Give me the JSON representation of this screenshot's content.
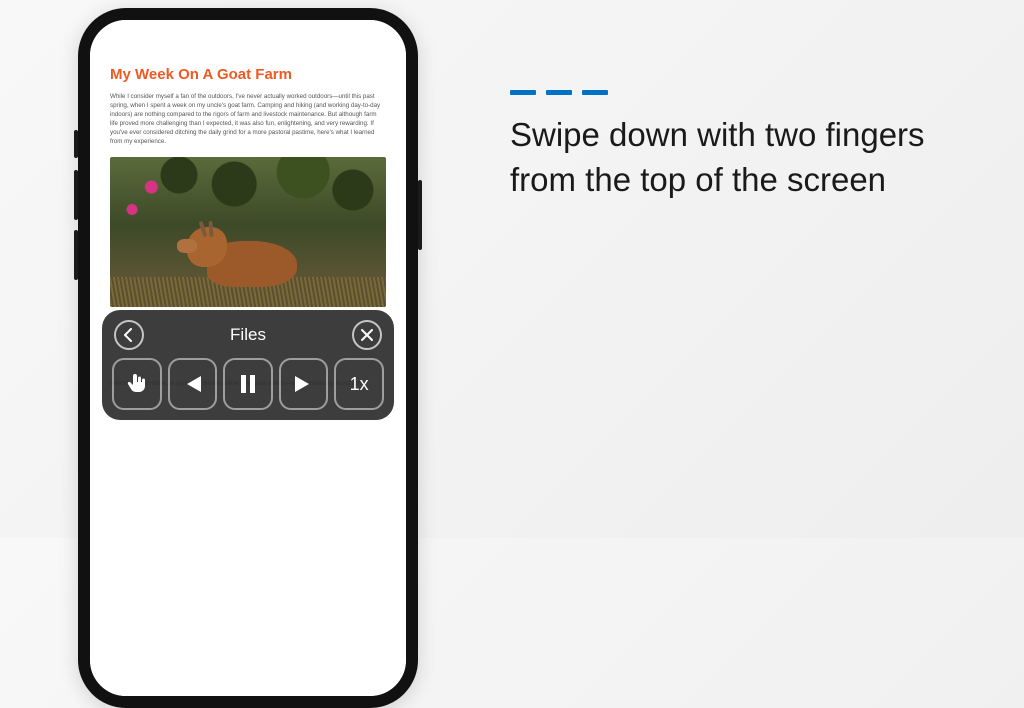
{
  "document": {
    "title": "My Week On A Goat Farm",
    "body": "While I consider myself a fan of the outdoors, I've never actually worked outdoors—until this past spring, when I spent a week on my uncle's goat farm. Camping and hiking (and working day-to-day indoors) are nothing compared to the rigors of farm and livestock maintenance. But although farm life proved more challenging than I expected, it was also fun, enlightening, and very rewarding. If you've ever considered ditching the daily grind for a more pastoral pastime, here's what I learned from my experience.",
    "image_alt": "goat-photo",
    "caption_tail": "devices, might nibble on your rose bushes rather than your weeds—as I accidentally found out."
  },
  "panel": {
    "title": "Files",
    "back_icon": "chevron-left-icon",
    "close_icon": "x-icon",
    "buttons": {
      "gesture": "hand-point-icon",
      "prev": "skip-back-icon",
      "playpause": "pause-icon",
      "next": "skip-forward-icon",
      "rate": "1x"
    }
  },
  "instruction": {
    "text": "Swipe down with two fingers from the top of the screen",
    "accent": "#0071c5"
  }
}
